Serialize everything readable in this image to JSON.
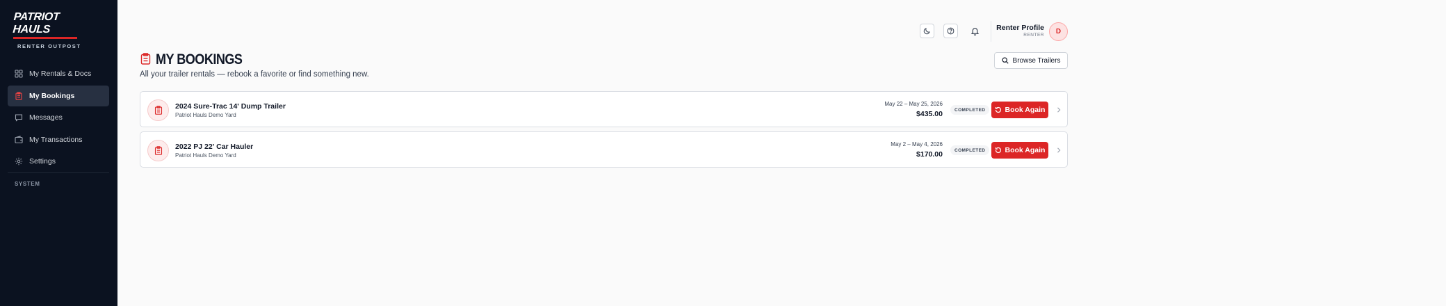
{
  "brand": {
    "title": "PATRIOT HAULS",
    "subtitle": "RENTER OUTPOST",
    "accent_color": "#dc2626"
  },
  "sidebar": {
    "items": [
      {
        "label": "My Rentals & Docs",
        "icon": "grid-icon",
        "active": false
      },
      {
        "label": "My Bookings",
        "icon": "clipboard-icon",
        "active": true
      },
      {
        "label": "Messages",
        "icon": "message-icon",
        "active": false
      },
      {
        "label": "My Transactions",
        "icon": "wallet-icon",
        "active": false
      },
      {
        "label": "Settings",
        "icon": "gear-icon",
        "active": false
      }
    ],
    "section_label": "SYSTEM"
  },
  "header": {
    "buttons": [
      {
        "icon": "moon-icon"
      },
      {
        "icon": "help-icon"
      },
      {
        "icon": "bell-icon"
      }
    ],
    "profile_name": "Renter Profile",
    "profile_role": "RENTER",
    "avatar_initial": "D"
  },
  "page": {
    "title": "MY BOOKINGS",
    "subtitle": "All your trailer rentals — rebook a favorite or find something new.",
    "browse_label": "Browse Trailers"
  },
  "bookings": [
    {
      "name": "2024 Sure-Trac 14' Dump Trailer",
      "location": "Patriot Hauls Demo Yard",
      "dates": "May 22 – May 25, 2026",
      "price": "$435.00",
      "status": "COMPLETED",
      "action_label": "Book Again"
    },
    {
      "name": "2022 PJ 22' Car Hauler",
      "location": "Patriot Hauls Demo Yard",
      "dates": "May 2 – May 4, 2026",
      "price": "$170.00",
      "status": "COMPLETED",
      "action_label": "Book Again"
    }
  ]
}
